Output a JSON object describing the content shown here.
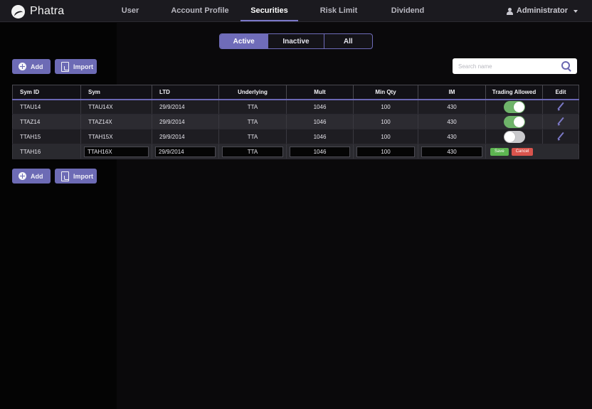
{
  "brand": {
    "name": "Phatra"
  },
  "nav": {
    "items": [
      {
        "label": "User"
      },
      {
        "label": "Account Profile"
      },
      {
        "label": "Securities"
      },
      {
        "label": "Risk Limit"
      },
      {
        "label": "Dividend"
      }
    ],
    "active": "Securities",
    "user": "Administrator"
  },
  "filter": {
    "options": [
      "Active",
      "Inactive",
      "All"
    ],
    "selected": "Active"
  },
  "actions": {
    "add_label": "Add",
    "import_label": "Import"
  },
  "search": {
    "placeholder": "Search name",
    "value": ""
  },
  "table": {
    "columns": [
      "Sym ID",
      "Sym",
      "LTD",
      "Underlying",
      "Mult",
      "Min Qty",
      "IM",
      "Trading Allowed",
      "Edit"
    ],
    "rows": [
      {
        "sym_id": "TTAU14",
        "sym": "TTAU14X",
        "ltd": "29/9/2014",
        "underlying": "TTA",
        "mult": "1046",
        "min_qty": "100",
        "im": "430",
        "trading_allowed": true
      },
      {
        "sym_id": "TTAZ14",
        "sym": "TTAZ14X",
        "ltd": "29/9/2014",
        "underlying": "TTA",
        "mult": "1046",
        "min_qty": "100",
        "im": "430",
        "trading_allowed": true
      },
      {
        "sym_id": "TTAH15",
        "sym": "TTAH15X",
        "ltd": "29/9/2014",
        "underlying": "TTA",
        "mult": "1046",
        "min_qty": "100",
        "im": "430",
        "trading_allowed": false
      }
    ],
    "edit_row": {
      "sym_id": "TTAH16",
      "sym": "TTAH16X",
      "ltd": "29/9/2014",
      "underlying": "TTA",
      "mult": "1046",
      "min_qty": "100",
      "im": "430",
      "save_label": "Save",
      "cancel_label": "Cancel"
    }
  },
  "colors": {
    "accent": "#6f6cb9",
    "toggle_on": "#6fb46a",
    "save": "#5db551",
    "cancel": "#d9544d"
  }
}
